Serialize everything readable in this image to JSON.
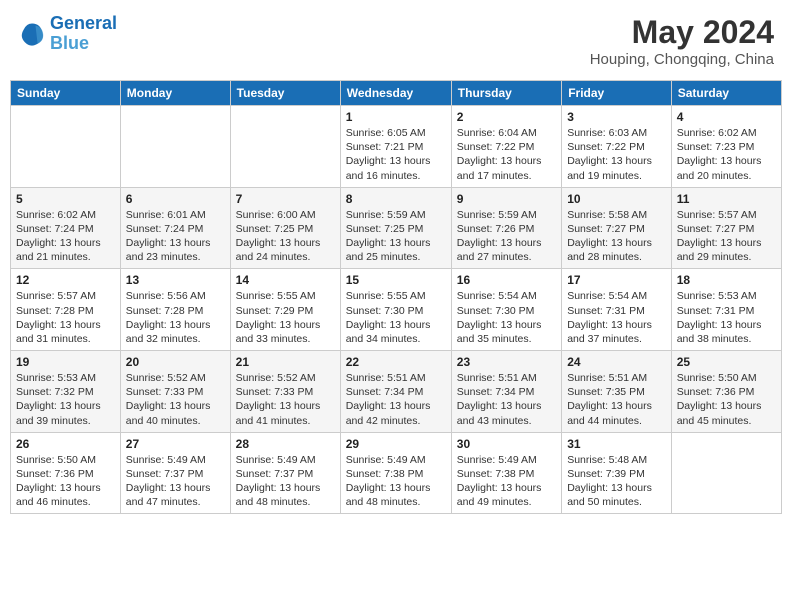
{
  "header": {
    "logo_line1": "General",
    "logo_line2": "Blue",
    "main_title": "May 2024",
    "subtitle": "Houping, Chongqing, China"
  },
  "weekdays": [
    "Sunday",
    "Monday",
    "Tuesday",
    "Wednesday",
    "Thursday",
    "Friday",
    "Saturday"
  ],
  "weeks": [
    [
      {
        "day": "",
        "sunrise": "",
        "sunset": "",
        "daylight": ""
      },
      {
        "day": "",
        "sunrise": "",
        "sunset": "",
        "daylight": ""
      },
      {
        "day": "",
        "sunrise": "",
        "sunset": "",
        "daylight": ""
      },
      {
        "day": "1",
        "sunrise": "Sunrise: 6:05 AM",
        "sunset": "Sunset: 7:21 PM",
        "daylight": "Daylight: 13 hours and 16 minutes."
      },
      {
        "day": "2",
        "sunrise": "Sunrise: 6:04 AM",
        "sunset": "Sunset: 7:22 PM",
        "daylight": "Daylight: 13 hours and 17 minutes."
      },
      {
        "day": "3",
        "sunrise": "Sunrise: 6:03 AM",
        "sunset": "Sunset: 7:22 PM",
        "daylight": "Daylight: 13 hours and 19 minutes."
      },
      {
        "day": "4",
        "sunrise": "Sunrise: 6:02 AM",
        "sunset": "Sunset: 7:23 PM",
        "daylight": "Daylight: 13 hours and 20 minutes."
      }
    ],
    [
      {
        "day": "5",
        "sunrise": "Sunrise: 6:02 AM",
        "sunset": "Sunset: 7:24 PM",
        "daylight": "Daylight: 13 hours and 21 minutes."
      },
      {
        "day": "6",
        "sunrise": "Sunrise: 6:01 AM",
        "sunset": "Sunset: 7:24 PM",
        "daylight": "Daylight: 13 hours and 23 minutes."
      },
      {
        "day": "7",
        "sunrise": "Sunrise: 6:00 AM",
        "sunset": "Sunset: 7:25 PM",
        "daylight": "Daylight: 13 hours and 24 minutes."
      },
      {
        "day": "8",
        "sunrise": "Sunrise: 5:59 AM",
        "sunset": "Sunset: 7:25 PM",
        "daylight": "Daylight: 13 hours and 25 minutes."
      },
      {
        "day": "9",
        "sunrise": "Sunrise: 5:59 AM",
        "sunset": "Sunset: 7:26 PM",
        "daylight": "Daylight: 13 hours and 27 minutes."
      },
      {
        "day": "10",
        "sunrise": "Sunrise: 5:58 AM",
        "sunset": "Sunset: 7:27 PM",
        "daylight": "Daylight: 13 hours and 28 minutes."
      },
      {
        "day": "11",
        "sunrise": "Sunrise: 5:57 AM",
        "sunset": "Sunset: 7:27 PM",
        "daylight": "Daylight: 13 hours and 29 minutes."
      }
    ],
    [
      {
        "day": "12",
        "sunrise": "Sunrise: 5:57 AM",
        "sunset": "Sunset: 7:28 PM",
        "daylight": "Daylight: 13 hours and 31 minutes."
      },
      {
        "day": "13",
        "sunrise": "Sunrise: 5:56 AM",
        "sunset": "Sunset: 7:28 PM",
        "daylight": "Daylight: 13 hours and 32 minutes."
      },
      {
        "day": "14",
        "sunrise": "Sunrise: 5:55 AM",
        "sunset": "Sunset: 7:29 PM",
        "daylight": "Daylight: 13 hours and 33 minutes."
      },
      {
        "day": "15",
        "sunrise": "Sunrise: 5:55 AM",
        "sunset": "Sunset: 7:30 PM",
        "daylight": "Daylight: 13 hours and 34 minutes."
      },
      {
        "day": "16",
        "sunrise": "Sunrise: 5:54 AM",
        "sunset": "Sunset: 7:30 PM",
        "daylight": "Daylight: 13 hours and 35 minutes."
      },
      {
        "day": "17",
        "sunrise": "Sunrise: 5:54 AM",
        "sunset": "Sunset: 7:31 PM",
        "daylight": "Daylight: 13 hours and 37 minutes."
      },
      {
        "day": "18",
        "sunrise": "Sunrise: 5:53 AM",
        "sunset": "Sunset: 7:31 PM",
        "daylight": "Daylight: 13 hours and 38 minutes."
      }
    ],
    [
      {
        "day": "19",
        "sunrise": "Sunrise: 5:53 AM",
        "sunset": "Sunset: 7:32 PM",
        "daylight": "Daylight: 13 hours and 39 minutes."
      },
      {
        "day": "20",
        "sunrise": "Sunrise: 5:52 AM",
        "sunset": "Sunset: 7:33 PM",
        "daylight": "Daylight: 13 hours and 40 minutes."
      },
      {
        "day": "21",
        "sunrise": "Sunrise: 5:52 AM",
        "sunset": "Sunset: 7:33 PM",
        "daylight": "Daylight: 13 hours and 41 minutes."
      },
      {
        "day": "22",
        "sunrise": "Sunrise: 5:51 AM",
        "sunset": "Sunset: 7:34 PM",
        "daylight": "Daylight: 13 hours and 42 minutes."
      },
      {
        "day": "23",
        "sunrise": "Sunrise: 5:51 AM",
        "sunset": "Sunset: 7:34 PM",
        "daylight": "Daylight: 13 hours and 43 minutes."
      },
      {
        "day": "24",
        "sunrise": "Sunrise: 5:51 AM",
        "sunset": "Sunset: 7:35 PM",
        "daylight": "Daylight: 13 hours and 44 minutes."
      },
      {
        "day": "25",
        "sunrise": "Sunrise: 5:50 AM",
        "sunset": "Sunset: 7:36 PM",
        "daylight": "Daylight: 13 hours and 45 minutes."
      }
    ],
    [
      {
        "day": "26",
        "sunrise": "Sunrise: 5:50 AM",
        "sunset": "Sunset: 7:36 PM",
        "daylight": "Daylight: 13 hours and 46 minutes."
      },
      {
        "day": "27",
        "sunrise": "Sunrise: 5:49 AM",
        "sunset": "Sunset: 7:37 PM",
        "daylight": "Daylight: 13 hours and 47 minutes."
      },
      {
        "day": "28",
        "sunrise": "Sunrise: 5:49 AM",
        "sunset": "Sunset: 7:37 PM",
        "daylight": "Daylight: 13 hours and 48 minutes."
      },
      {
        "day": "29",
        "sunrise": "Sunrise: 5:49 AM",
        "sunset": "Sunset: 7:38 PM",
        "daylight": "Daylight: 13 hours and 48 minutes."
      },
      {
        "day": "30",
        "sunrise": "Sunrise: 5:49 AM",
        "sunset": "Sunset: 7:38 PM",
        "daylight": "Daylight: 13 hours and 49 minutes."
      },
      {
        "day": "31",
        "sunrise": "Sunrise: 5:48 AM",
        "sunset": "Sunset: 7:39 PM",
        "daylight": "Daylight: 13 hours and 50 minutes."
      },
      {
        "day": "",
        "sunrise": "",
        "sunset": "",
        "daylight": ""
      }
    ]
  ]
}
